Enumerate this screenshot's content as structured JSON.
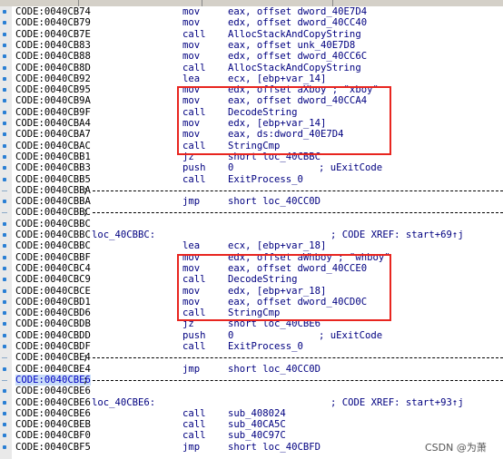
{
  "tabs": [
    "",
    "",
    "",
    "",
    "",
    ""
  ],
  "rows": [
    {
      "addr": "CODE:0040CB74",
      "mn": "mov",
      "op": "eax, offset dword_40E7D4"
    },
    {
      "addr": "CODE:0040CB79",
      "mn": "mov",
      "op": "edx, offset dword_40CC40"
    },
    {
      "addr": "CODE:0040CB7E",
      "mn": "call",
      "op": "AllocStackAndCopyString"
    },
    {
      "addr": "CODE:0040CB83",
      "mn": "mov",
      "op": "eax, offset unk_40E7D8"
    },
    {
      "addr": "CODE:0040CB88",
      "mn": "mov",
      "op": "edx, offset dword_40CC6C"
    },
    {
      "addr": "CODE:0040CB8D",
      "mn": "call",
      "op": "AllocStackAndCopyString"
    },
    {
      "addr": "CODE:0040CB92",
      "mn": "lea",
      "op": "ecx, [ebp+var_14]"
    },
    {
      "addr": "CODE:0040CB95",
      "mn": "mov",
      "op": "edx, offset aXboy ; \"xboy\""
    },
    {
      "addr": "CODE:0040CB9A",
      "mn": "mov",
      "op": "eax, offset dword_40CCA4"
    },
    {
      "addr": "CODE:0040CB9F",
      "mn": "call",
      "op": "DecodeString"
    },
    {
      "addr": "CODE:0040CBA4",
      "mn": "mov",
      "op": "edx, [ebp+var_14]"
    },
    {
      "addr": "CODE:0040CBA7",
      "mn": "mov",
      "op": "eax, ds:dword_40E7D4"
    },
    {
      "addr": "CODE:0040CBAC",
      "mn": "call",
      "op": "StringCmp"
    },
    {
      "addr": "CODE:0040CBB1",
      "mn": "jz",
      "op": "short loc_40CBBC"
    },
    {
      "addr": "CODE:0040CBB3",
      "mn": "push",
      "op": "0",
      "cmt": "; uExitCode"
    },
    {
      "addr": "CODE:0040CBB5",
      "mn": "call",
      "op": "ExitProcess_0"
    },
    {
      "addr": "CODE:0040CBBA",
      "sep": true
    },
    {
      "addr": "CODE:0040CBBA",
      "mn": "jmp",
      "op": "short loc_40CC0D"
    },
    {
      "addr": "CODE:0040CBBC",
      "sep": true
    },
    {
      "addr": "CODE:0040CBBC"
    },
    {
      "addr": "CODE:0040CBBC",
      "label": "loc_40CBBC:",
      "cmt": "; CODE XREF: start+69↑j"
    },
    {
      "addr": "CODE:0040CBBC",
      "mn": "lea",
      "op": "ecx, [ebp+var_18]"
    },
    {
      "addr": "CODE:0040CBBF",
      "mn": "mov",
      "op": "edx, offset aWhboy ; \"whboy\""
    },
    {
      "addr": "CODE:0040CBC4",
      "mn": "mov",
      "op": "eax, offset dword_40CCE0"
    },
    {
      "addr": "CODE:0040CBC9",
      "mn": "call",
      "op": "DecodeString"
    },
    {
      "addr": "CODE:0040CBCE",
      "mn": "mov",
      "op": "edx, [ebp+var_18]"
    },
    {
      "addr": "CODE:0040CBD1",
      "mn": "mov",
      "op": "eax, offset dword_40CD0C"
    },
    {
      "addr": "CODE:0040CBD6",
      "mn": "call",
      "op": "StringCmp"
    },
    {
      "addr": "CODE:0040CBDB",
      "mn": "jz",
      "op": "short loc_40CBE6"
    },
    {
      "addr": "CODE:0040CBDD",
      "mn": "push",
      "op": "0",
      "cmt": "; uExitCode"
    },
    {
      "addr": "CODE:0040CBDF",
      "mn": "call",
      "op": "ExitProcess_0"
    },
    {
      "addr": "CODE:0040CBE4",
      "sep": true
    },
    {
      "addr": "CODE:0040CBE4",
      "mn": "jmp",
      "op": "short loc_40CC0D"
    },
    {
      "addr": "CODE:0040CBE6",
      "sep": true,
      "cur": true
    },
    {
      "addr": "CODE:0040CBE6"
    },
    {
      "addr": "CODE:0040CBE6",
      "label": "loc_40CBE6:",
      "cmt": "; CODE XREF: start+93↑j"
    },
    {
      "addr": "CODE:0040CBE6",
      "mn": "call",
      "op": "sub_408024"
    },
    {
      "addr": "CODE:0040CBEB",
      "mn": "call",
      "op": "sub_40CA5C"
    },
    {
      "addr": "CODE:0040CBF0",
      "mn": "call",
      "op": "sub_40C97C"
    },
    {
      "addr": "CODE:0040CBF5",
      "mn": "jmp",
      "op": "short loc_40CBFD"
    }
  ],
  "watermark": "CSDN @为萧",
  "colors": {
    "highlight_box": "#e8251f",
    "code_text": "#000080",
    "address": "#000000",
    "background": "#ffffff"
  }
}
